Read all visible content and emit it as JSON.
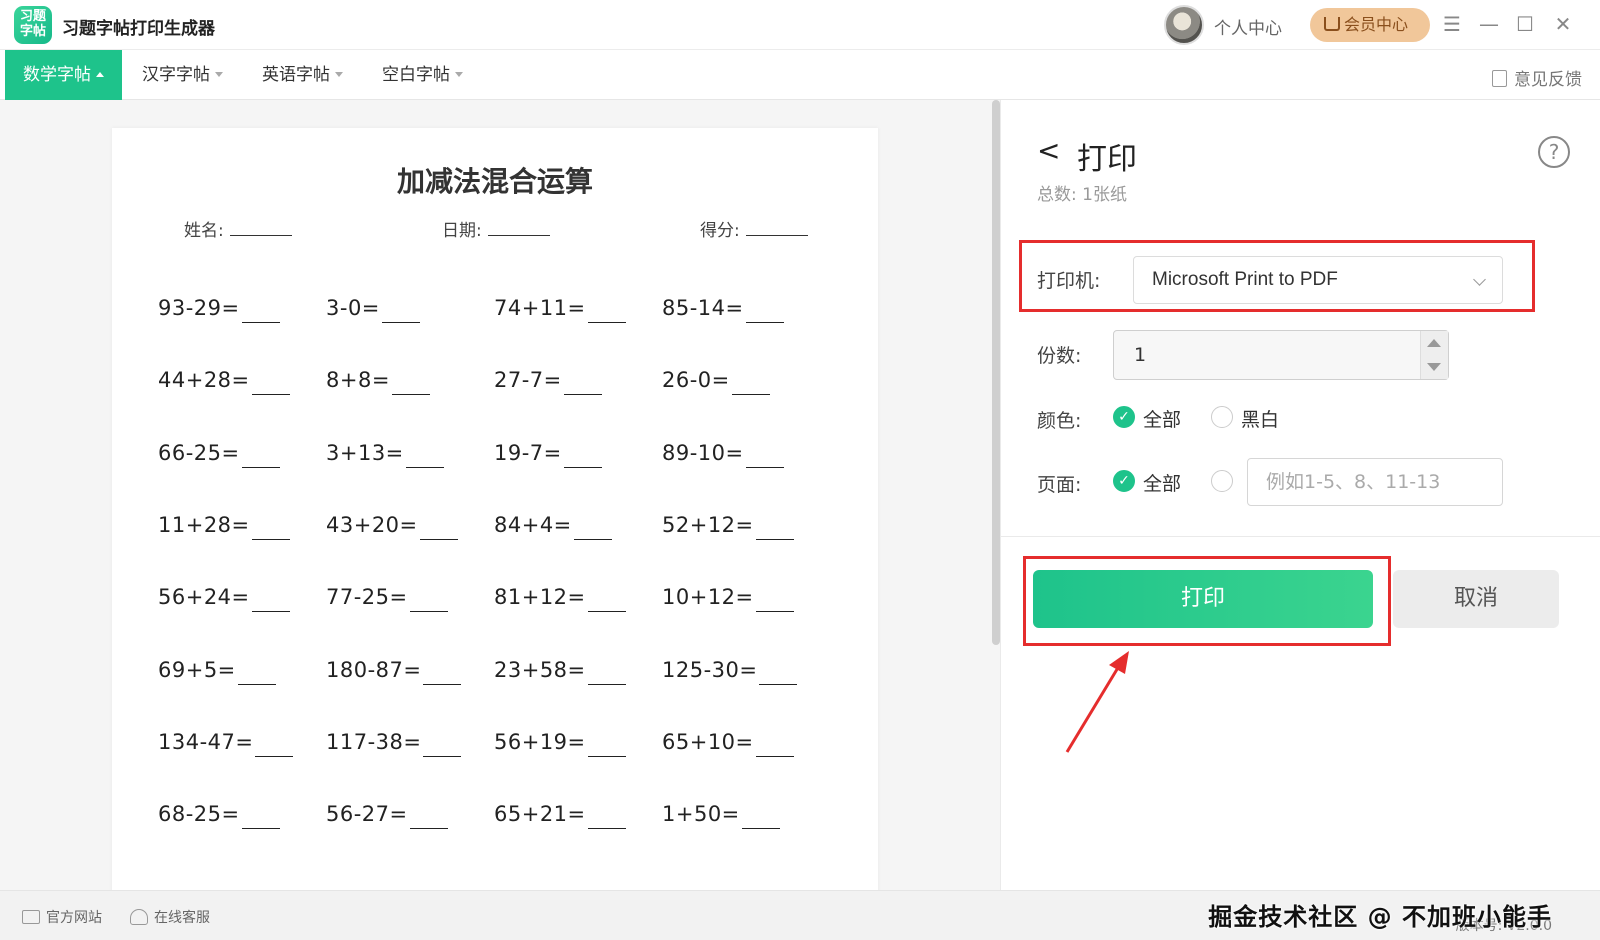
{
  "app": {
    "title": "习题字帖打印生成器",
    "logo_line1": "习题",
    "logo_line2": "字帖",
    "personal_center": "个人中心",
    "vip_center": "会员中心"
  },
  "window_controls": {
    "menu": "☰",
    "minimize": "—",
    "maximize": "☐",
    "close": "✕"
  },
  "tabs": [
    {
      "label": "数学字帖",
      "active": true
    },
    {
      "label": "汉字字帖",
      "active": false
    },
    {
      "label": "英语字帖",
      "active": false
    },
    {
      "label": "空白字帖",
      "active": false
    }
  ],
  "feedback": "意见反馈",
  "sheet": {
    "title": "加减法混合运算",
    "name_label": "姓名:",
    "date_label": "日期:",
    "score_label": "得分:",
    "problems": [
      [
        "93-29=",
        "3-0=",
        "74+11=",
        "85-14="
      ],
      [
        "44+28=",
        "8+8=",
        "27-7=",
        "26-0="
      ],
      [
        "66-25=",
        "3+13=",
        "19-7=",
        "89-10="
      ],
      [
        "11+28=",
        "43+20=",
        "84+4=",
        "52+12="
      ],
      [
        "56+24=",
        "77-25=",
        "81+12=",
        "10+12="
      ],
      [
        "69+5=",
        "180-87=",
        "23+58=",
        "125-30="
      ],
      [
        "134-47=",
        "117-38=",
        "56+19=",
        "65+10="
      ],
      [
        "68-25=",
        "56-27=",
        "65+21=",
        "1+50="
      ]
    ]
  },
  "print_panel": {
    "back": "<",
    "title": "打印",
    "help": "?",
    "total": "总数: 1张纸",
    "printer_label": "打印机:",
    "printer_value": "Microsoft Print to PDF",
    "copies_label": "份数:",
    "copies_value": "1",
    "color_label": "颜色:",
    "color_options": [
      "全部",
      "黑白"
    ],
    "color_selected": "全部",
    "pages_label": "页面:",
    "pages_options": [
      "全部"
    ],
    "pages_selected": "全部",
    "pages_placeholder": "例如1-5、8、11-13",
    "print_button": "打印",
    "cancel_button": "取消",
    "highlight_color": "#e52d2d",
    "accent_color": "#1ec38b"
  },
  "footer": {
    "official_site": "官方网站",
    "online_service": "在线客服",
    "watermark": "掘金技术社区 @ 不加班小能手",
    "version": "版本号: V2.0.0"
  },
  "icons": [
    "crown-icon",
    "menu-icon",
    "minimize-icon",
    "maximize-icon",
    "close-icon",
    "feedback-icon",
    "help-icon",
    "chevron-down-icon",
    "check-icon",
    "monitor-icon",
    "headset-icon"
  ]
}
